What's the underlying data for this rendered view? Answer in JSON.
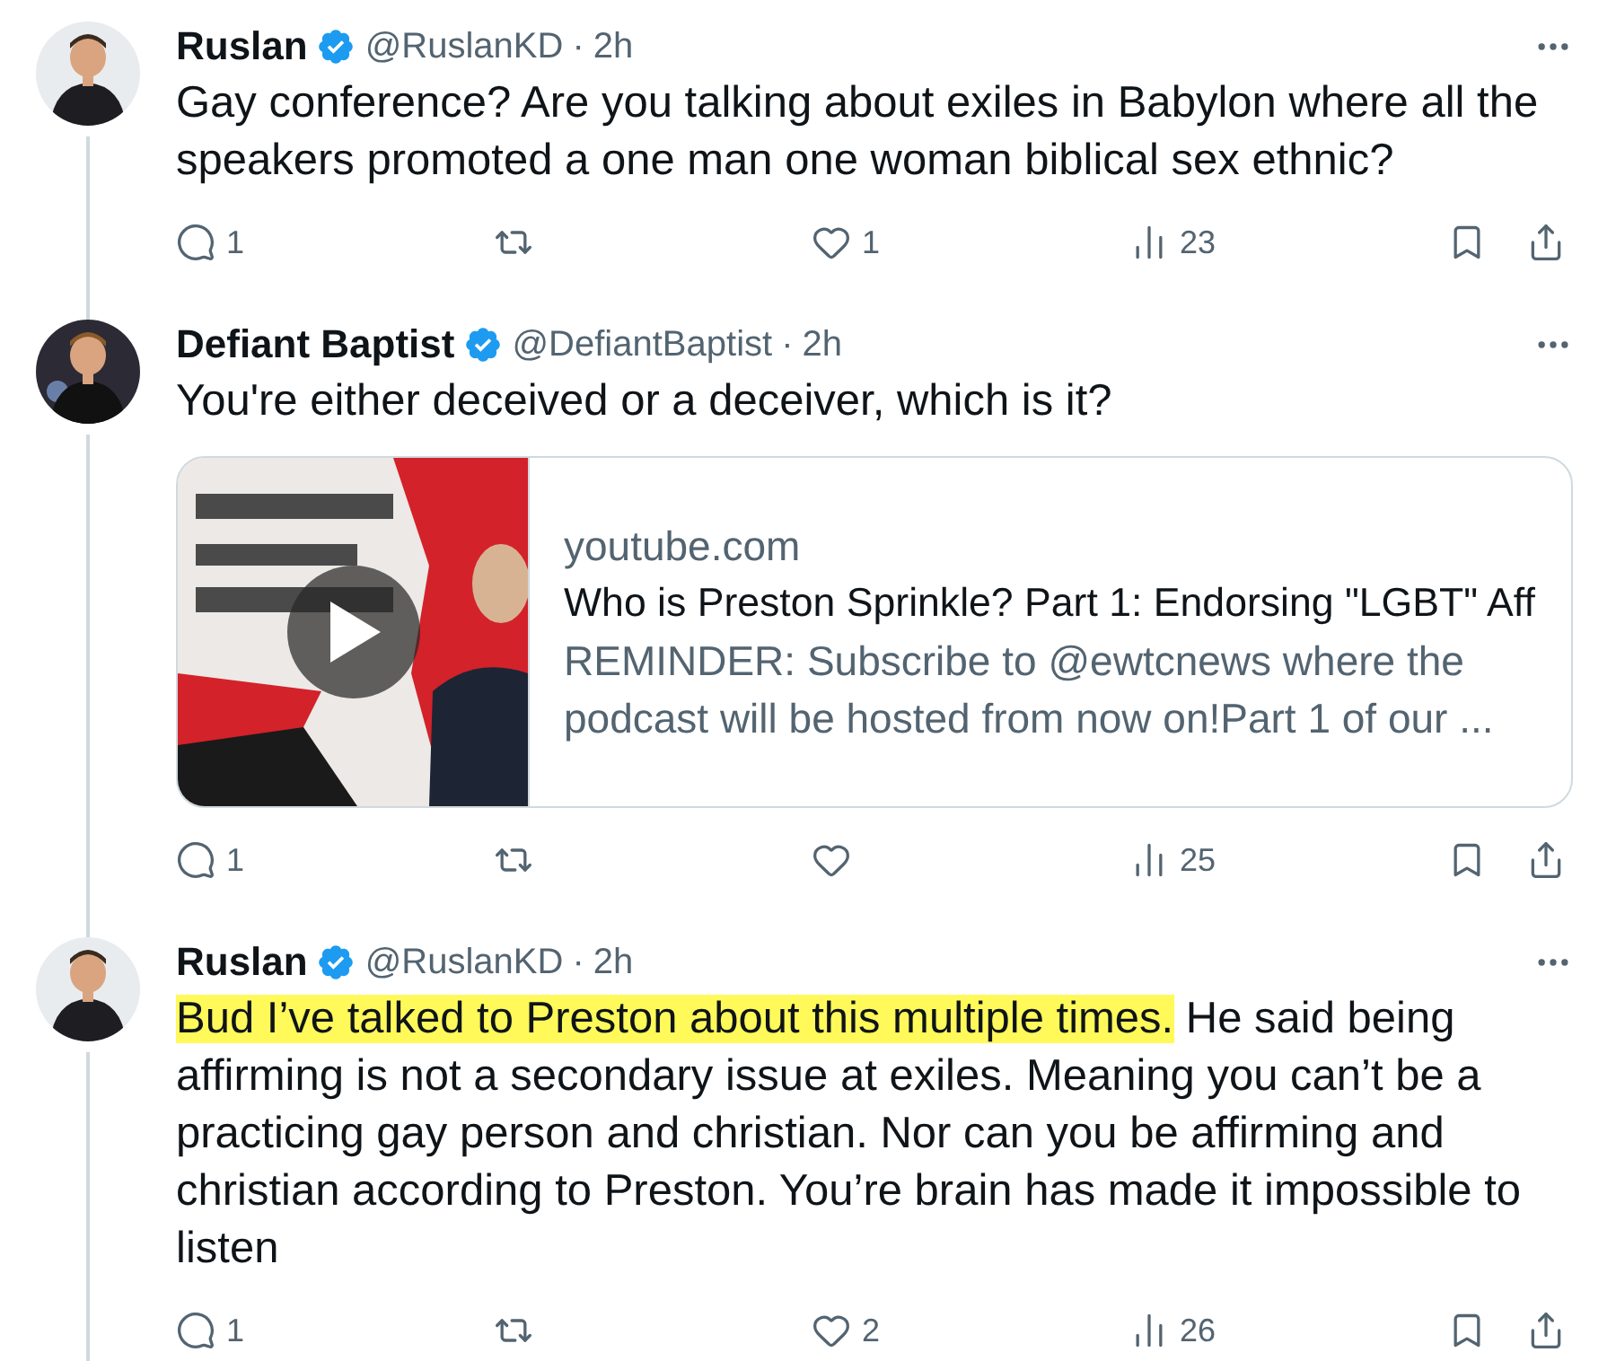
{
  "tweets": [
    {
      "name": "Ruslan",
      "verified": true,
      "handle": "@RuslanKD",
      "separator": "·",
      "time": "2h",
      "avatar": {
        "kind": "picture"
      },
      "body": [
        {
          "text": "Gay conference? Are you talking about exiles in Babylon where all the speakers promoted a one man one woman biblical sex ethnic?",
          "highlighted": false
        }
      ],
      "actions": [
        {
          "kind": "reply",
          "count": "1"
        },
        {
          "kind": "repost"
        },
        {
          "kind": "like",
          "count": "1"
        },
        {
          "kind": "views",
          "count": "23"
        },
        {
          "kind": "bookmark"
        },
        {
          "kind": "share"
        }
      ]
    },
    {
      "name": "Defiant Baptist",
      "verified": true,
      "handle": "@DefiantBaptist",
      "separator": "·",
      "time": "2h",
      "avatar": {
        "kind": "picture"
      },
      "body": [
        {
          "text": "You're either deceived or a deceiver, which is it?",
          "highlighted": false
        }
      ],
      "card": {
        "thumbnail": {
          "kind": "picture"
        },
        "domain": "youtube.com",
        "title": "Who is Preston Sprinkle? Part 1: Endorsing \"LGBT\" Aff",
        "description": "REMINDER: Subscribe to @ewtcnews where the podcast will be hosted from now on!Part 1 of our ..."
      },
      "actions": [
        {
          "kind": "reply",
          "count": "1"
        },
        {
          "kind": "repost"
        },
        {
          "kind": "like"
        },
        {
          "kind": "views",
          "count": "25"
        },
        {
          "kind": "bookmark"
        },
        {
          "kind": "share"
        }
      ]
    },
    {
      "name": "Ruslan",
      "verified": true,
      "handle": "@RuslanKD",
      "separator": "·",
      "time": "2h",
      "avatar": {
        "kind": "picture"
      },
      "body": [
        {
          "text": "Bud I’ve talked to Preston about this multiple times.",
          "highlighted": true
        },
        {
          "text": " He said being affirming is not a secondary issue at exiles. Meaning you can’t be a practicing gay person and christian. Nor can you be affirming and christian according to Preston. You’re brain has made it impossible to listen",
          "highlighted": false
        }
      ],
      "actions": [
        {
          "kind": "reply",
          "count": "1"
        },
        {
          "kind": "repost"
        },
        {
          "kind": "like",
          "count": "2"
        },
        {
          "kind": "views",
          "count": "26"
        },
        {
          "kind": "bookmark"
        },
        {
          "kind": "share"
        }
      ]
    }
  ]
}
